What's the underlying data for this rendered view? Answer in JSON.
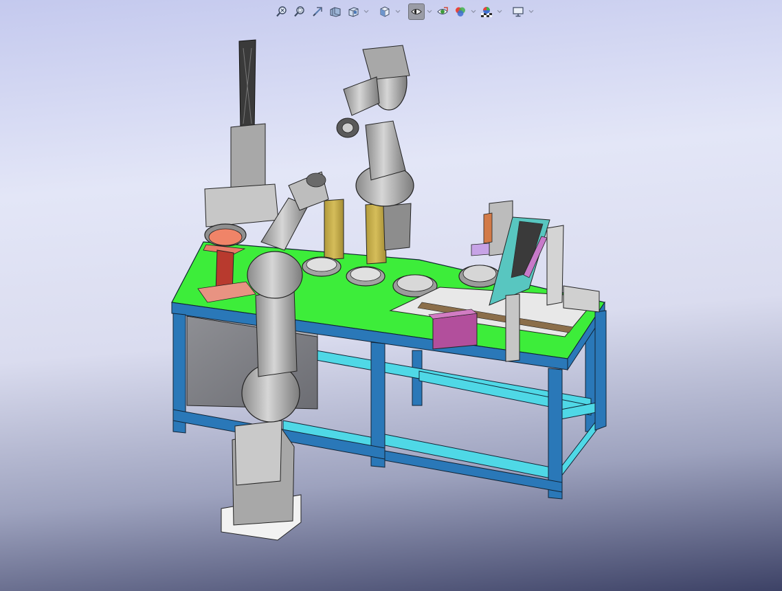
{
  "window": {
    "title": ""
  },
  "toolbar": {
    "items": [
      {
        "icon": "zoom-to-fit-icon",
        "has_dropdown": false
      },
      {
        "icon": "zoom-to-area-icon",
        "has_dropdown": false
      },
      {
        "icon": "previous-view-icon",
        "has_dropdown": false
      },
      {
        "icon": "section-view-icon",
        "has_dropdown": false
      },
      {
        "icon": "dynamic-annotation-views-icon",
        "has_dropdown": true
      },
      {
        "icon": "view-orientation-icon",
        "has_dropdown": true
      },
      {
        "icon": "display-style-icon",
        "has_dropdown": true
      },
      {
        "icon": "hide-show-items-icon",
        "has_dropdown": false
      },
      {
        "icon": "edit-appearance-icon",
        "has_dropdown": true
      },
      {
        "icon": "apply-scene-icon",
        "has_dropdown": false
      },
      {
        "icon": "view-settings-icon",
        "has_dropdown": true
      }
    ],
    "active_item": "display-style-icon"
  },
  "colors": {
    "table_top": "#3ded3a",
    "table_frame": "#2a78b8",
    "table_braces": "#4fd8e6",
    "robot_body": "#b9b9b9",
    "fixture_tan": "#c9b04a",
    "pedestal_red": "#b83a2e",
    "block_magenta": "#b24f9c",
    "conveyor_teal": "#58c6c0"
  }
}
